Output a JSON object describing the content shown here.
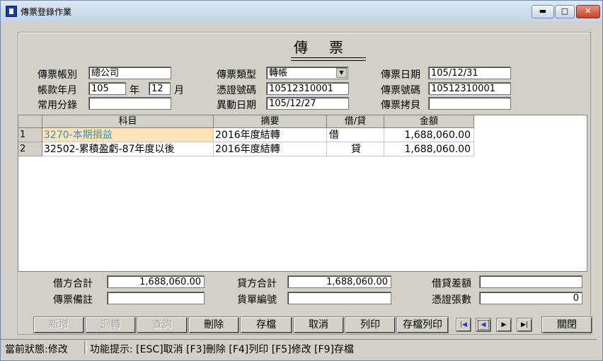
{
  "window": {
    "title": "傳票登錄作業",
    "min_label": "▬",
    "max_label": "□",
    "close_label": "✕"
  },
  "voucher_title": "傳票",
  "header": {
    "account_type_label": "傳票帳別",
    "account_type_value": "總公司",
    "period_label": "帳款年月",
    "year_value": "105",
    "year_unit": "年",
    "month_value": "12",
    "month_unit": "月",
    "common_entry_label": "常用分錄",
    "common_entry_value": "",
    "voucher_type_label": "傳票類型",
    "voucher_type_value": "轉帳",
    "voucher_proof_label": "憑證號碼",
    "voucher_proof_value": "10512310001",
    "change_date_label": "異動日期",
    "change_date_value": "105/12/27",
    "voucher_date_label": "傳票日期",
    "voucher_date_value": "105/12/31",
    "voucher_no_label": "傳票號碼",
    "voucher_no_value": "10512310001",
    "voucher_copy_label": "傳票拷貝",
    "voucher_copy_value": ""
  },
  "grid": {
    "columns": [
      "科目",
      "摘要",
      "借/貸",
      "金額"
    ],
    "rows": [
      {
        "no": "1",
        "account": "3270-本期損益",
        "summary": "2016年度結轉",
        "dc": "借",
        "amount": "1,688,060.00"
      },
      {
        "no": "2",
        "account": "32502-累積盈虧-87年度以後",
        "summary": "2016年度結轉",
        "dc": "貸",
        "amount": "1,688,060.00"
      }
    ]
  },
  "totals": {
    "debit_label": "借方合計",
    "debit_value": "1,688,060.00",
    "credit_label": "貸方合計",
    "credit_value": "1,688,060.00",
    "diff_label": "借貸差額",
    "diff_value": "",
    "remark_label": "傳票備註",
    "remark_value": "",
    "bill_no_label": "貨單編號",
    "bill_no_value": "",
    "proof_count_label": "憑證張數",
    "proof_count_value": "0"
  },
  "buttons": {
    "add": "新增",
    "reverse": "迴轉",
    "query": "查詢",
    "delete": "刪除",
    "save": "存檔",
    "cancel": "取消",
    "print": "列印",
    "save_print": "存檔列印",
    "close": "關閉"
  },
  "nav": {
    "first": "|◀",
    "prev": "◀",
    "next": "▶",
    "last": "▶|"
  },
  "status": {
    "state": "當前狀態:修改",
    "hint": "功能提示: [ESC]取消 [F3]刪除 [F4]列印 [F5]修改 [F9]存檔"
  },
  "colors": {
    "highlight_text": "#3a8fbf",
    "selected_row_bg": "#fbe3b4"
  }
}
